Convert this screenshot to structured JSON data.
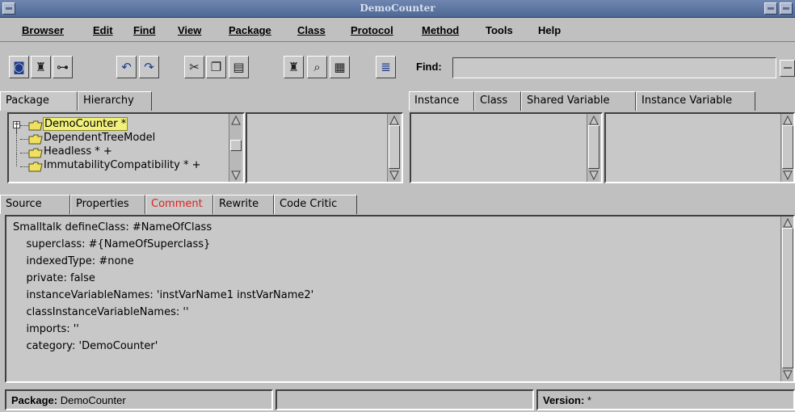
{
  "window": {
    "title": "DemoCounter"
  },
  "menu": [
    "Browser",
    "Edit",
    "Find",
    "View",
    "Package",
    "Class",
    "Protocol",
    "Method",
    "Tools",
    "Help"
  ],
  "toolbar": {
    "buttons": [
      "browse-icon",
      "find-references-icon",
      "browse-hierarchy-icon",
      "undo-icon",
      "redo-icon",
      "cut-icon",
      "copy-icon",
      "paste-icon",
      "find-senders-icon",
      "find-implementors-icon",
      "find-class-icon",
      "format-code-icon"
    ],
    "find_label": "Find:",
    "find_value": ""
  },
  "left_tabs": [
    "Package",
    "Hierarchy"
  ],
  "right_tabs": [
    "Instance",
    "Class",
    "Shared Variable",
    "Instance Variable"
  ],
  "packages": [
    {
      "label": "DemoCounter *",
      "selected": true
    },
    {
      "label": "DependentTreeModel",
      "selected": false
    },
    {
      "label": "Headless * +",
      "selected": false
    },
    {
      "label": "ImmutabilityCompatibility * +",
      "selected": false
    }
  ],
  "code_tabs": [
    "Source",
    "Properties",
    "Comment",
    "Rewrite",
    "Code Critic"
  ],
  "code_lines": [
    "Smalltalk defineClass: #NameOfClass",
    "    superclass: #{NameOfSuperclass}",
    "    indexedType: #none",
    "    private: false",
    "    instanceVariableNames: 'instVarName1 instVarName2'",
    "    classInstanceVariableNames: ''",
    "    imports: ''",
    "    category: 'DemoCounter'"
  ],
  "status": {
    "package_label": "Package:",
    "package_value": "DemoCounter",
    "middle": "",
    "version_label": "Version:",
    "version_value": "*"
  },
  "colors": {
    "title_bg": "#5a7199",
    "selection": "#f0f07a",
    "active_tab_text": "#e02020"
  }
}
